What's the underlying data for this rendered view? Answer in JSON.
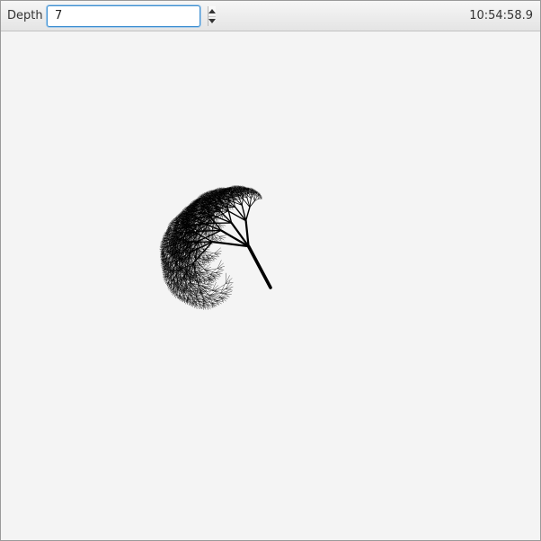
{
  "toolbar": {
    "depth_label": "Depth",
    "depth_value": "7",
    "clock": "10:54:58.9"
  },
  "tree": {
    "depth": 7,
    "stroke_color": "#000000"
  }
}
